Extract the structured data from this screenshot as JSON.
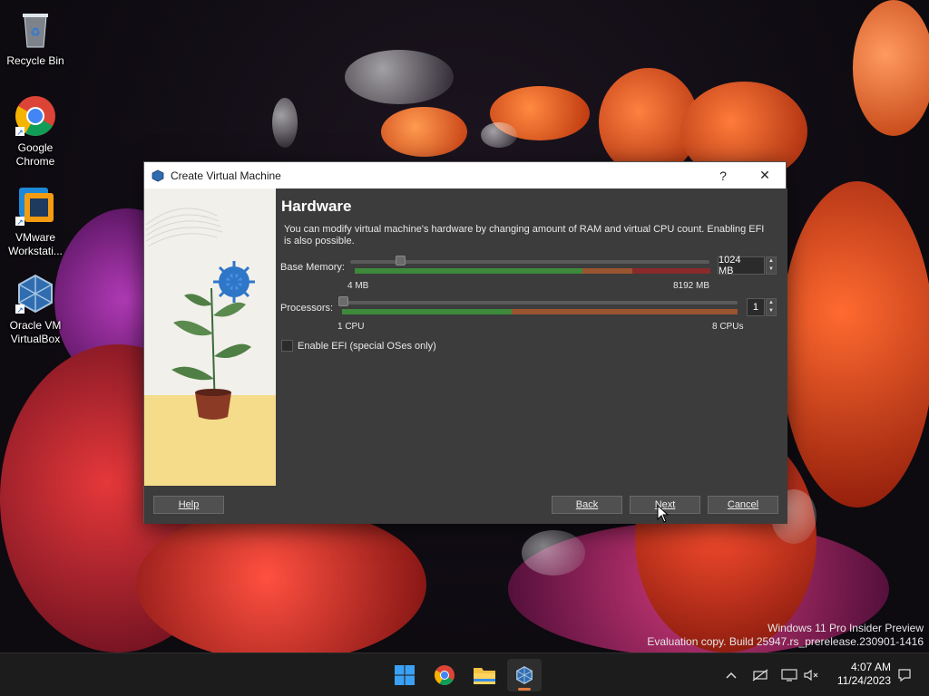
{
  "desktop": {
    "icons": [
      {
        "label": "Recycle Bin",
        "icon": "recycle-bin-icon"
      },
      {
        "label": "Google Chrome",
        "icon": "chrome-icon"
      },
      {
        "label": "VMware Workstati...",
        "icon": "vmware-icon"
      },
      {
        "label": "Oracle VM VirtualBox",
        "icon": "virtualbox-icon"
      }
    ]
  },
  "dialog": {
    "title": "Create Virtual Machine",
    "help_symbol": "?",
    "close_symbol": "✕",
    "heading": "Hardware",
    "description": "You can modify virtual machine's hardware by changing amount of RAM and virtual CPU count. Enabling EFI is also possible.",
    "memory": {
      "label": "Base Memory:",
      "value": "1024 MB",
      "min_label": "4 MB",
      "max_label": "8192 MB",
      "level": 0.125
    },
    "processors": {
      "label": "Processors:",
      "value": "1",
      "min_label": "1 CPU",
      "max_label": "8 CPUs",
      "level": 0.0
    },
    "efi": {
      "label": "Enable EFI (special OSes only)",
      "checked": false
    },
    "buttons": {
      "help": "Help",
      "back": "Back",
      "next": "Next",
      "cancel": "Cancel"
    }
  },
  "watermark": {
    "line1": "Windows 11 Pro Insider Preview",
    "line2": "Evaluation copy. Build 25947.rs_prerelease.230901-1416"
  },
  "taskbar": {
    "apps": [
      "start-icon",
      "chrome-icon",
      "file-explorer-icon",
      "virtualbox-icon"
    ],
    "time": "4:07 AM",
    "date": "11/24/2023"
  },
  "colors": {
    "accent": "#e07a3c",
    "dialog_bg": "#3c3c3c",
    "scale_green": "#3d8a3a",
    "scale_orange": "#9a5530",
    "scale_red": "#8a2a2a"
  }
}
